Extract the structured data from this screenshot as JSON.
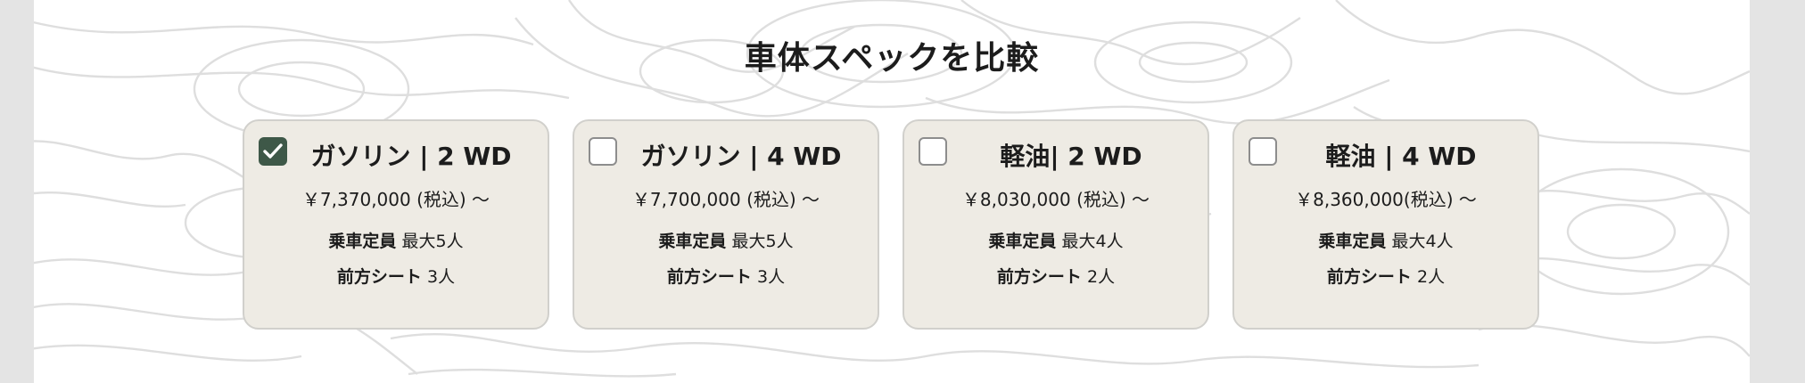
{
  "section": {
    "title": "車体スペックを比較"
  },
  "cards": [
    {
      "checked": true,
      "title": "ガソリン | 2 WD",
      "price": "￥7,370,000 (税込) 〜",
      "capacity_label": "乗車定員",
      "capacity_value": "最大5人",
      "front_seat_label": "前方シート",
      "front_seat_value": "3人"
    },
    {
      "checked": false,
      "title": "ガソリン | 4 WD",
      "price": "￥7,700,000 (税込)  〜",
      "capacity_label": "乗車定員",
      "capacity_value": "最大5人",
      "front_seat_label": "前方シート",
      "front_seat_value": "3人"
    },
    {
      "checked": false,
      "title": "軽油| 2 WD",
      "price": "￥8,030,000 (税込) 〜",
      "capacity_label": "乗車定員",
      "capacity_value": "最大4人",
      "front_seat_label": "前方シート",
      "front_seat_value": "2人"
    },
    {
      "checked": false,
      "title": "軽油 | 4 WD",
      "price": "￥8,360,000(税込)  〜",
      "capacity_label": "乗車定員",
      "capacity_value": "最大4人",
      "front_seat_label": "前方シート",
      "front_seat_value": "2人"
    }
  ],
  "colors": {
    "check_accent": "#3e5848",
    "card_background": "#eeebe4",
    "card_border": "#d1d0cc",
    "topo_lines": "#dedede"
  },
  "icons": {
    "checkmark": "check-icon",
    "background": "topographic-pattern"
  }
}
